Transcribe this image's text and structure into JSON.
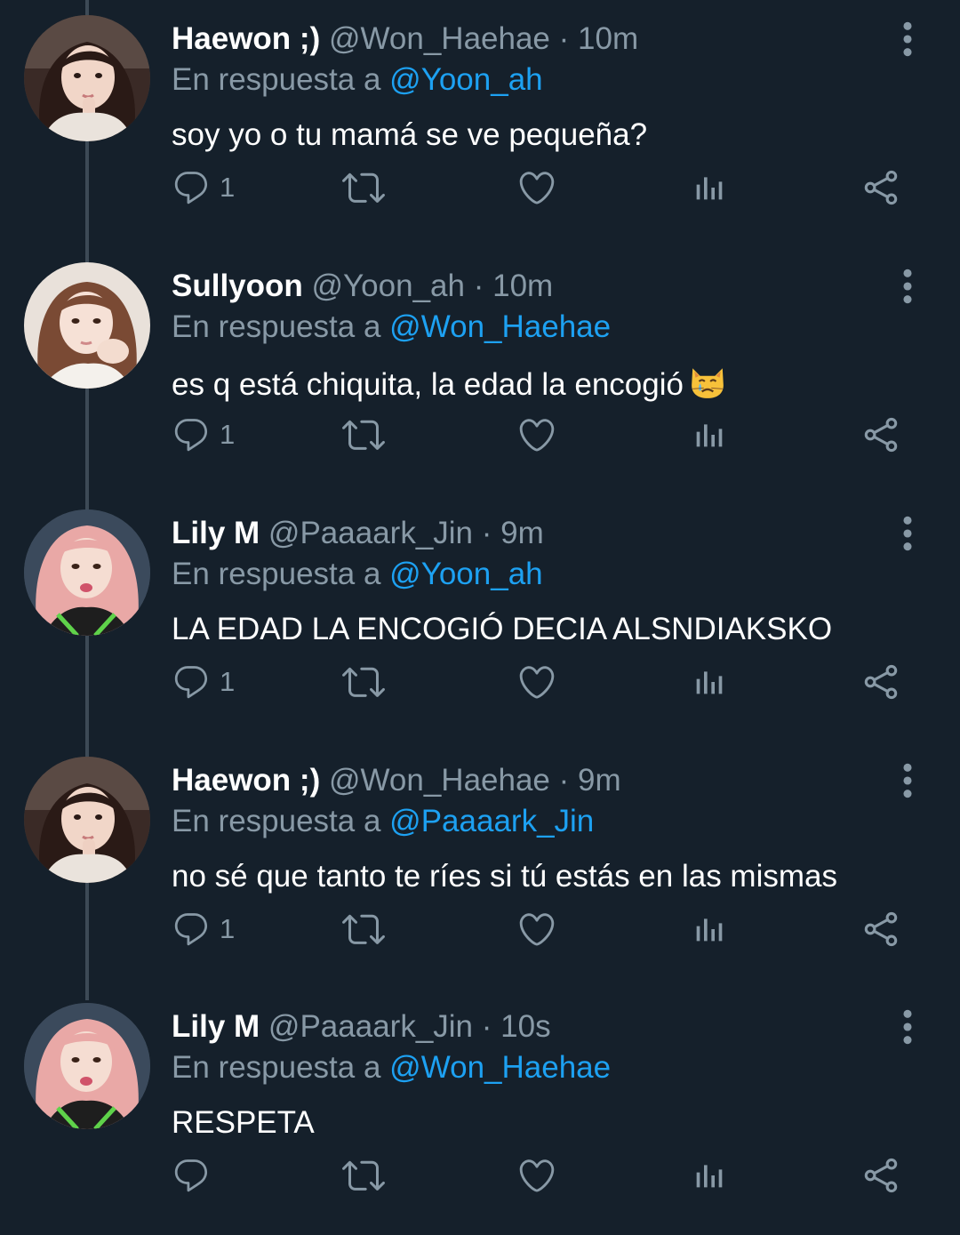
{
  "colors": {
    "background": "#15202b",
    "name": "#ffffff",
    "secondary": "#8899a6",
    "link": "#1da1f2",
    "thread_line": "#3d4a56"
  },
  "tweets": [
    {
      "name": "Haewon ;)",
      "handle": "@Won_Haehae",
      "sep": "·",
      "time": "10m",
      "reply_prefix": "En respuesta a",
      "reply_to": "@Yoon_ah",
      "text": "soy yo o tu mamá se ve pequeña?",
      "reply_count": "1",
      "avatar_icon": "avatar-haewon"
    },
    {
      "name": "Sullyoon",
      "handle": "@Yoon_ah",
      "sep": "·",
      "time": "10m",
      "reply_prefix": "En respuesta a",
      "reply_to": "@Won_Haehae",
      "text": "es q está chiquita, la edad la encogió",
      "emoji": "crying-cat-face",
      "reply_count": "1",
      "avatar_icon": "avatar-sullyoon"
    },
    {
      "name": "Lily M",
      "handle": "@Paaaark_Jin",
      "sep": "·",
      "time": "9m",
      "reply_prefix": "En respuesta a",
      "reply_to": "@Yoon_ah",
      "text": "LA EDAD LA ENCOGIÓ DECIA ALSNDIAKSKO",
      "reply_count": "1",
      "avatar_icon": "avatar-lily"
    },
    {
      "name": "Haewon ;)",
      "handle": "@Won_Haehae",
      "sep": "·",
      "time": "9m",
      "reply_prefix": "En respuesta a",
      "reply_to": "@Paaaark_Jin",
      "text": "no sé que tanto te ríes si tú estás en las mismas",
      "reply_count": "1",
      "avatar_icon": "avatar-haewon"
    },
    {
      "name": "Lily M",
      "handle": "@Paaaark_Jin",
      "sep": "·",
      "time": "10s",
      "reply_prefix": "En respuesta a",
      "reply_to": "@Won_Haehae",
      "text": "RESPETA",
      "reply_count": "",
      "avatar_icon": "avatar-lily"
    }
  ]
}
